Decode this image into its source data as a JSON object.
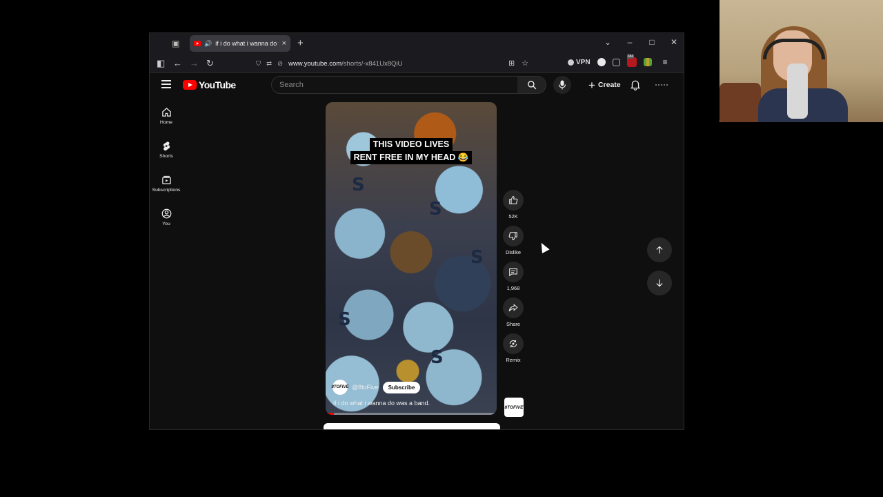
{
  "browser": {
    "tab_title": "if i do what i wanna do was",
    "url_host": "www.youtube.com",
    "url_path": "/shorts/-x841Ux8QiU",
    "vpn_label": "VPN",
    "ext_badge": "284"
  },
  "youtube": {
    "logo_text": "YouTube",
    "search_placeholder": "Search",
    "create_label": "Create",
    "sidebar": [
      {
        "label": "Home",
        "icon": "home-icon"
      },
      {
        "label": "Shorts",
        "icon": "shorts-icon"
      },
      {
        "label": "Subscriptions",
        "icon": "subscriptions-icon"
      },
      {
        "label": "You",
        "icon": "you-icon"
      }
    ]
  },
  "short": {
    "caption_line1": "THIS VIDEO LIVES",
    "caption_line2": "RENT FREE IN MY HEAD 😂",
    "channel_handle": "@8toFive",
    "avatar_text": "8TOFIVE",
    "subscribe_label": "Subscribe",
    "title": "if i do what i wanna do was a band.",
    "progress": 0.05,
    "actions": {
      "like_count": "52K",
      "dislike_label": "Dislike",
      "comment_count": "1,968",
      "share_label": "Share",
      "remix_label": "Remix"
    }
  },
  "colors": {
    "youtube_red": "#ff0000",
    "page_bg": "#0f0f0f",
    "button_bg": "#272727"
  }
}
